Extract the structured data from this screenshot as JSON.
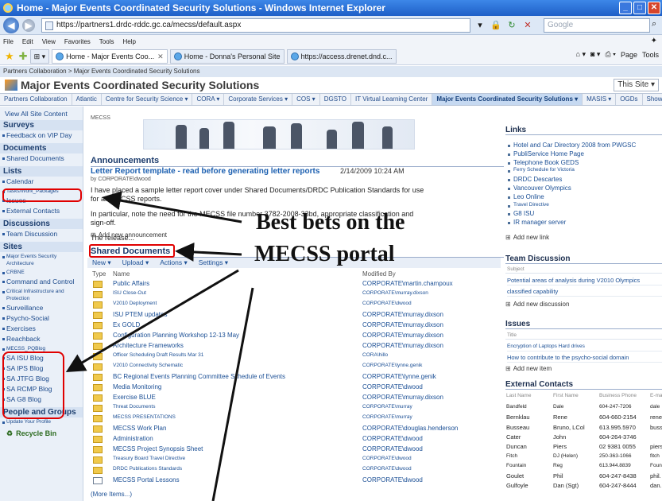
{
  "browser": {
    "title": "Home - Major Events Coordinated Security Solutions - Windows Internet Explorer",
    "url": "https://partners1.drdc-rddc.gc.ca/mecss/default.aspx",
    "search_placeholder": "Google",
    "menu": [
      "File",
      "Edit",
      "View",
      "Favorites",
      "Tools",
      "Help"
    ],
    "tabs": [
      {
        "label": "Home - Major Events Coo...",
        "active": true
      },
      {
        "label": "Home - Donna's Personal Site",
        "active": false
      },
      {
        "label": "https://access.drenet.dnd.c...",
        "active": false
      }
    ],
    "commands": [
      "Page",
      "Tools"
    ]
  },
  "site": {
    "breadcrumb": "Partners Collaboration > Major Events Coordinated Security Solutions",
    "title": "Major Events Coordinated Security Solutions",
    "search_scope": "This Site",
    "topnav": [
      "Partners Collaboration",
      "Atlantic",
      "Centre for Security Science ▾",
      "CORA ▾",
      "Corporate Services ▾",
      "COS ▾",
      "DGSTO",
      "IT Virtual Learning Center",
      "Major Events Coordinated Security Solutions ▾",
      "MASIS ▾",
      "OGDs",
      "Showcase Templa"
    ],
    "topnav_selected": 8
  },
  "quicklaunch": {
    "view_all": "View All Site Content",
    "surveys_head": "Surveys",
    "surveys": [
      "Feedback on VIP Day"
    ],
    "documents_head": "Documents",
    "documents": [
      "Shared Documents"
    ],
    "lists_head": "Lists",
    "lists": [
      "Calendar",
      "Tasks/Work_Packages",
      "Issues",
      "External Contacts"
    ],
    "discussions_head": "Discussions",
    "discussions": [
      "Team Discussion"
    ],
    "sites_head": "Sites",
    "sites": [
      "Major Events Security Architecture",
      "CRBNE",
      "Command and Control",
      "Critical Infrastructure and Protection",
      "Surveillance",
      "Psycho-Social",
      "Exercises",
      "Reachback",
      "MECSS_PQBlog",
      "SA ISU Blog",
      "SA IPS Blog",
      "SA JTFG Blog",
      "SA RCMP Blog",
      "SA G8 Blog"
    ],
    "people_head": "People and Groups",
    "people": [
      "Update Your Profile"
    ],
    "recycle": "Recycle Bin"
  },
  "main": {
    "mecss_label": "MECSS",
    "announcements_title": "Announcements",
    "announcement": {
      "title": "Letter Report template - read before generating letter reports",
      "date": "2/14/2009 10:24 AM",
      "by": "by CORPORATE\\dwood",
      "line1": "I have placed a sample letter report cover under Shared Documents/DRDC Publication Standards for use for all MECSS reports.",
      "line2": "In particular, note the need for the MECSS file number 3782-2008-33bd, appropriate classification and sign-off.",
      "line3": "The release..."
    },
    "add_announcement": "Add new announcement",
    "shared_title": "Shared Documents",
    "toolbar": [
      "New ▾",
      "Upload ▾",
      "Actions ▾",
      "Settings ▾"
    ],
    "columns": [
      "Type",
      "Name",
      "Modified By"
    ],
    "documents": [
      {
        "name": "Public Affairs",
        "by": "CORPORATE\\martin.champoux"
      },
      {
        "name": "ISU Close-Out",
        "by": "CORPORATE\\murray.dixson"
      },
      {
        "name": "V2010 Deployment",
        "by": "CORPORATE\\dwood"
      },
      {
        "name": "ISU PTEM updates",
        "by": "CORPORATE\\murray.dixson"
      },
      {
        "name": "Ex GOLD",
        "by": "CORPORATE\\murray.dixson"
      },
      {
        "name": "Configuration Planning Workshop 12-13 May",
        "by": "CORPORATE\\murray.dixson"
      },
      {
        "name": "Architecture Frameworks",
        "by": "CORPORATE\\murray.dixson"
      },
      {
        "name": "Officer Scheduling Draft Results Mar 31",
        "by": "CORA\\hillo"
      },
      {
        "name": "V2010 Connectivity Schematic",
        "by": "CORPORATE\\lynne.genik"
      },
      {
        "name": "BC Regional Events Planning Committee Schedule of Events",
        "by": "CORPORATE\\lynne.genik"
      },
      {
        "name": "Media Monitoring",
        "by": "CORPORATE\\dwood"
      },
      {
        "name": "Exercise BLUE",
        "by": "CORPORATE\\murray.dixson"
      },
      {
        "name": "Threat Documents",
        "by": "CORPORATE\\murray"
      },
      {
        "name": "MECSS PRESENTATIONS",
        "by": "CORPORATE\\murray"
      },
      {
        "name": "MECSS Work Plan",
        "by": "CORPORATE\\douglas.henderson"
      },
      {
        "name": "Administration",
        "by": "CORPORATE\\dwood"
      },
      {
        "name": "MECSS Project Synopsis Sheet",
        "by": "CORPORATE\\dwood"
      },
      {
        "name": "Treasury Board Travel Directive",
        "by": "CORPORATE\\dwood"
      },
      {
        "name": "DRDC Publications Standards",
        "by": "CORPORATE\\dwood"
      },
      {
        "name": "MECSS Portal Lessons",
        "by": "CORPORATE\\dwood"
      }
    ],
    "more_items": "(More Items...)"
  },
  "overlay": {
    "line1": "Best bets on the",
    "line2": "MECSS portal"
  },
  "right": {
    "links_title": "Links",
    "links": [
      "Hotel and Car Directory 2008 from PWGSC",
      "PubliService Home Page",
      "Telephone Book GEDS",
      "Ferry Schedule for Victoria",
      "DRDC Descartes",
      "Vancouver Olympics",
      "Leo Online",
      "Travel Directive",
      "G8 ISU",
      "IR manager server"
    ],
    "add_link": "Add new link",
    "team_title": "Team Discussion",
    "team_subject": "Subject",
    "team_items": [
      "Potential areas of analysis during V2010 Olympics",
      "classified capability"
    ],
    "add_discussion": "Add new discussion",
    "issues_title": "Issues",
    "issues_col": "Title",
    "issues": [
      "Encryption of Laptops Hard drives",
      "How to contribute to the psycho-social domain"
    ],
    "add_item": "Add new item",
    "contacts_title": "External Contacts",
    "contacts_cols": [
      "Last Name",
      "First Name",
      "Business Phone",
      "E-ma"
    ],
    "contacts": [
      [
        "Bandfeld",
        "Dale",
        "604-247-7206",
        "dale"
      ],
      [
        "Bernklau",
        "Rene",
        "604-660-2154",
        "rene"
      ],
      [
        "Busseau",
        "Bruno, LCol",
        "613.995.5970",
        "buss"
      ],
      [
        "Cater",
        "John",
        "604-264-3746",
        ""
      ],
      [
        "Duncan",
        "Piers",
        "02 9381 0055",
        "piers"
      ],
      [
        "Fitch",
        "DJ (Helen)",
        "250-363-1066",
        "fitch"
      ],
      [
        "Fountain",
        "Reg",
        "613.944.8839",
        "Foun"
      ],
      [
        "Goulet",
        "Phil",
        "604-247-8438",
        "phil."
      ],
      [
        "Gulfoyle",
        "Dan (Sgt)",
        "604-247-8444",
        "dan."
      ]
    ]
  }
}
